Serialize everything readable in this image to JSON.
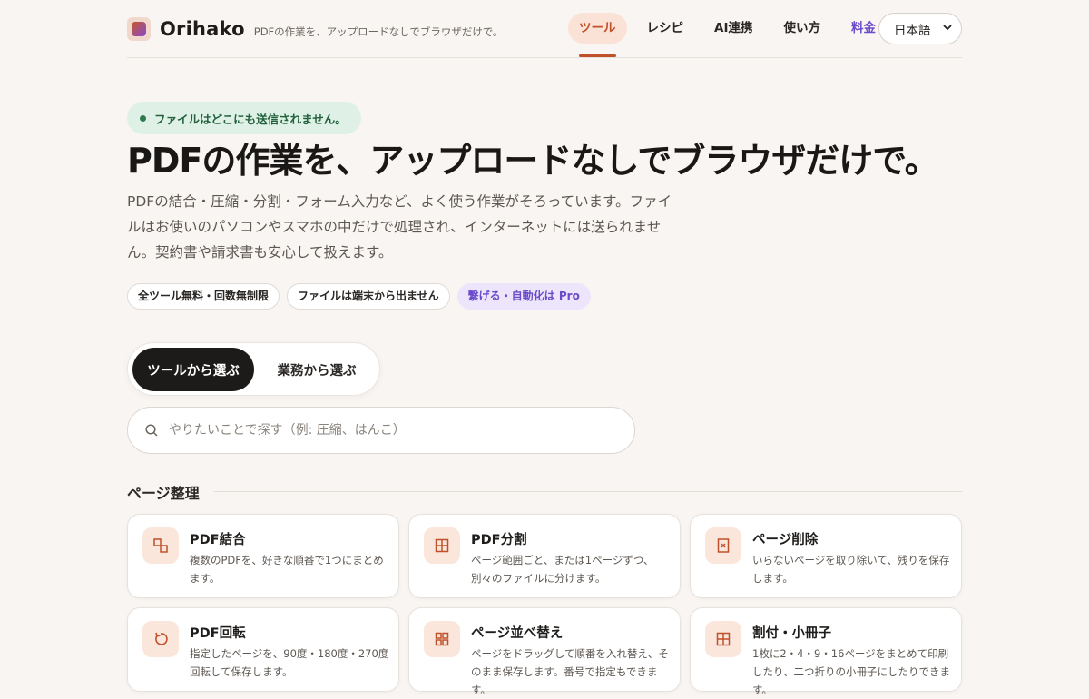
{
  "brand": {
    "name": "Orihako",
    "tagline": "PDFの作業を、アップロードなしでブラウザだけで。"
  },
  "nav": {
    "items": [
      {
        "label": "ツール",
        "active": true
      },
      {
        "label": "レシピ"
      },
      {
        "label": "AI連携"
      },
      {
        "label": "使い方"
      },
      {
        "label": "料金"
      }
    ],
    "language": "日本語"
  },
  "hero": {
    "badge": "ファイルはどこにも送信されません。",
    "title": "PDFの作業を、アップロードなしでブラウザだけで。",
    "description": "PDFの結合・圧縮・分割・フォーム入力など、よく使う作業がそろっています。ファイルはお使いのパソコンやスマホの中だけで処理され、インターネットには送られません。契約書や請求書も安心して扱えます。",
    "chips": [
      "全ツール無料・回数無制限",
      "ファイルは端末から出ません",
      "繋げる・自動化は Pro"
    ]
  },
  "segment": {
    "tools": "ツールから選ぶ",
    "tasks": "業務から選ぶ"
  },
  "search": {
    "placeholder": "やりたいことで探す（例: 圧縮、はんこ）"
  },
  "section": {
    "title": "ページ整理",
    "cards": [
      {
        "title": "PDF結合",
        "desc": "複数のPDFを、好きな順番で1つにまとめます。",
        "icon": "merge-icon"
      },
      {
        "title": "PDF分割",
        "desc": "ページ範囲ごと、または1ページずつ、別々のファイルに分けます。",
        "icon": "split-icon"
      },
      {
        "title": "ページ削除",
        "desc": "いらないページを取り除いて、残りを保存します。",
        "icon": "delete-page-icon"
      },
      {
        "title": "PDF回転",
        "desc": "指定したページを、90度・180度・270度回転して保存します。",
        "icon": "rotate-icon"
      },
      {
        "title": "ページ並べ替え",
        "desc": "ページをドラッグして順番を入れ替え、そのまま保存します。番号で指定もできます。",
        "icon": "reorder-icon"
      },
      {
        "title": "割付・小冊子",
        "desc": "1枚に2・4・9・16ページをまとめて印刷したり、二つ折りの小冊子にしたりできます。",
        "icon": "layout-icon"
      }
    ]
  },
  "colors": {
    "accent": "#c0502a",
    "pro": "#6a4bc9",
    "secure": "#23613e",
    "background": "#f8f5f2"
  }
}
